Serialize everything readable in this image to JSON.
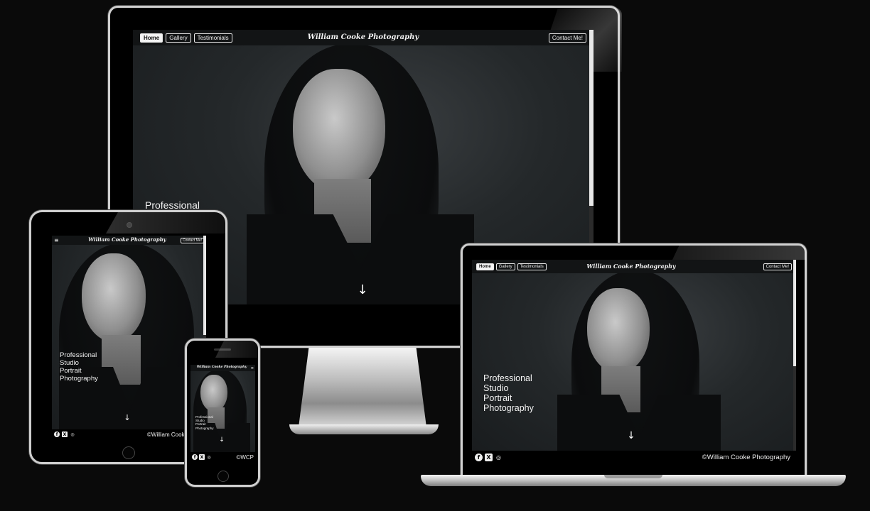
{
  "site": {
    "brand": "William Cooke Photography",
    "nav": [
      "Home",
      "Gallery",
      "Testimonials"
    ],
    "contact_label": "Contact Me!",
    "hero_lines": [
      "Professional",
      "Studio",
      "Portrait",
      "Photography"
    ],
    "copyright_full": "©William Cooke Photography",
    "copyright_tablet": "©William Cooke Photo",
    "copyright_short": "©WCP",
    "socials": [
      "facebook-icon",
      "x-icon",
      "instagram-icon"
    ],
    "social_glyphs": [
      "f",
      "X",
      "◎"
    ],
    "scroll_arrow": "↓",
    "menu_glyph": "≡"
  },
  "colors": {
    "background": "#0a0a0a",
    "nav_bg": "#121415",
    "footer_bg": "#000000",
    "text": "#f3f3f3"
  }
}
